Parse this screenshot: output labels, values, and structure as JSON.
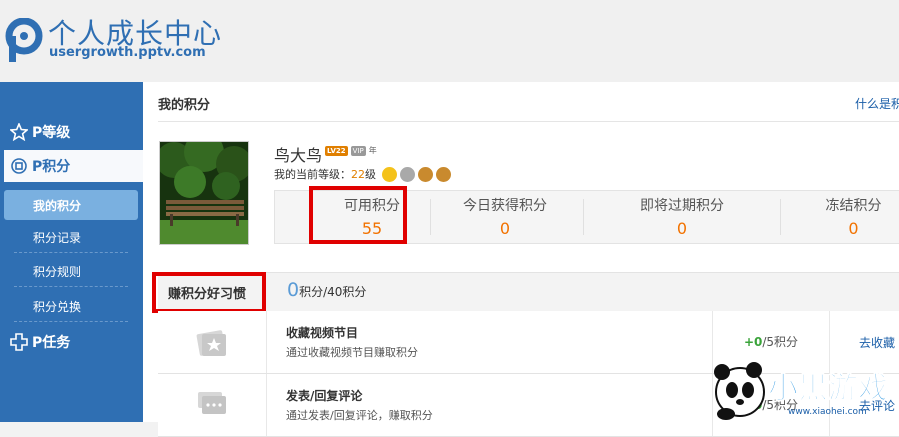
{
  "brand": {
    "title": "个人成长中心",
    "url": "usergrowth.pptv.com"
  },
  "sidebar": {
    "level_label": "P等级",
    "points_label": "P积分",
    "sub_items": [
      "我的积分",
      "积分记录",
      "积分规则",
      "积分兑换"
    ],
    "task_label": "P任务"
  },
  "main": {
    "title": "我的积分",
    "what_link": "什么是积",
    "user": {
      "name": "鸟大鸟",
      "badge_level": "LV22",
      "badge_vip": "VIP",
      "badge_year": "年",
      "level_prefix": "我的当前等级：",
      "level_num": "22",
      "level_suffix": "级"
    },
    "stats": [
      {
        "label": "可用积分",
        "value": "55"
      },
      {
        "label": "今日获得积分",
        "value": "0"
      },
      {
        "label": "即将过期积分",
        "value": "0"
      },
      {
        "label": "冻结积分",
        "value": "0"
      }
    ],
    "earn": {
      "title": "赚积分好习惯",
      "count": "0",
      "count_suffix": "积分/40积分"
    },
    "tasks": [
      {
        "name": "收藏视频节目",
        "desc": "通过收藏视频节目赚取积分",
        "points_done": "+0",
        "points_total": "/5积分",
        "action": "去收藏"
      },
      {
        "name": "发表/回复评论",
        "desc": "通过发表/回复评论，赚取积分",
        "points_done": "+0",
        "points_total": "/5积分",
        "action": "去评论"
      }
    ]
  },
  "watermark": {
    "text": "小黑游戏",
    "url": "www.xiaohei.com"
  },
  "colors": {
    "brand_blue": "#2f6fb3",
    "accent_orange": "#f27200",
    "highlight_red": "#e00000"
  }
}
